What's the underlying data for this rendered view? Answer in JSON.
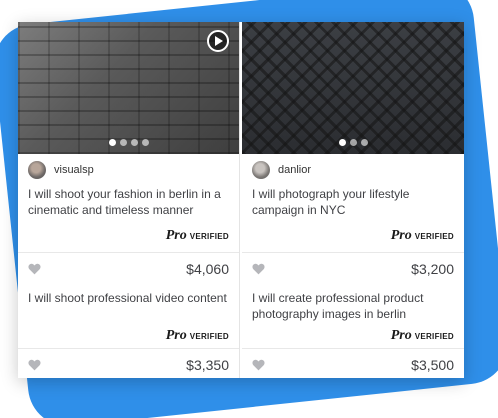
{
  "gigs": [
    {
      "seller": "visualsp",
      "title": "I will shoot your fashion in berlin in a cinematic and timeless manner",
      "pro_label": "Pro",
      "verified_label": "VERIFIED",
      "price": "$4,060",
      "photo": "black-and-white portrait photo",
      "has_video": true,
      "carousel_count": 4,
      "carousel_active": 0
    },
    {
      "seller": "danlior",
      "title": "I will photograph your lifestyle campaign in NYC",
      "pro_label": "Pro",
      "verified_label": "VERIFIED",
      "price": "$3,200",
      "photo": "color portrait photo",
      "has_video": false,
      "carousel_count": 3,
      "carousel_active": 0
    },
    {
      "title": "I will shoot professional video content",
      "pro_label": "Pro",
      "verified_label": "VERIFIED",
      "price": "$3,350"
    },
    {
      "title": "I will create professional product photography images in berlin",
      "pro_label": "Pro",
      "verified_label": "VERIFIED",
      "price": "$3,500"
    }
  ],
  "colors": {
    "background_blob": "#2f8fe9",
    "text": "#404145",
    "heart": "#b5b6ba"
  },
  "icons": {
    "favorite": "heart-icon",
    "video": "play-icon"
  }
}
